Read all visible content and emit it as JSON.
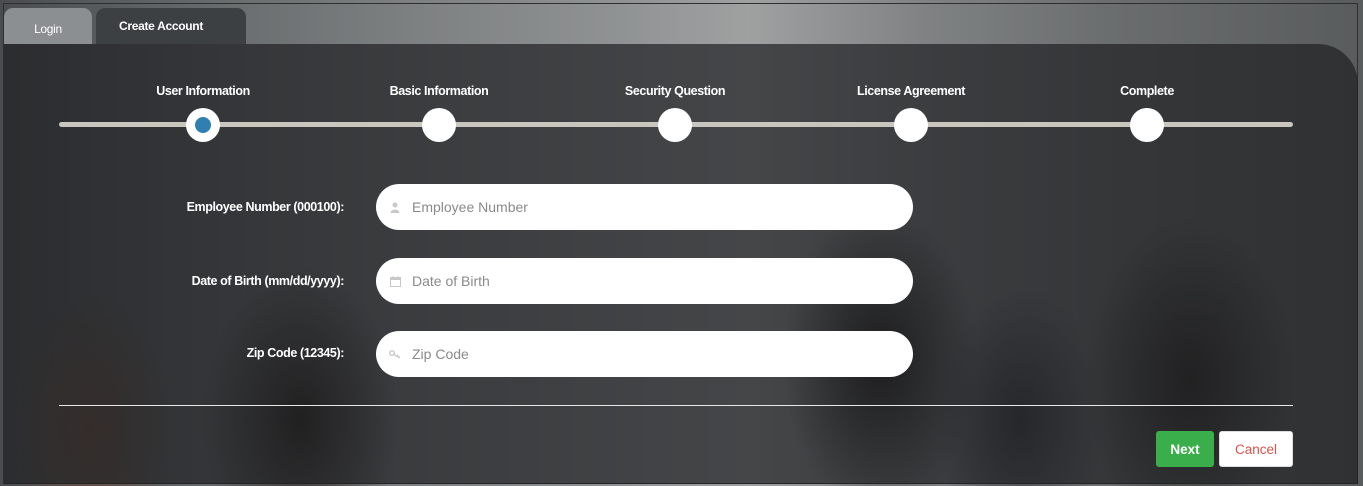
{
  "tabs": [
    {
      "label": "Login"
    },
    {
      "label": "Create Account"
    }
  ],
  "steps": [
    {
      "label": "User Information",
      "active": true
    },
    {
      "label": "Basic Information",
      "active": false
    },
    {
      "label": "Security Question",
      "active": false
    },
    {
      "label": "License Agreement",
      "active": false
    },
    {
      "label": "Complete",
      "active": false
    }
  ],
  "form": {
    "employee_number": {
      "label": "Employee Number (000100):",
      "placeholder": "Employee Number",
      "icon": "user-icon",
      "value": ""
    },
    "date_of_birth": {
      "label": "Date of Birth (mm/dd/yyyy):",
      "placeholder": "Date of Birth",
      "icon": "calendar-icon",
      "value": ""
    },
    "zip_code": {
      "label": "Zip Code (12345):",
      "placeholder": "Zip Code",
      "icon": "key-icon",
      "value": ""
    }
  },
  "buttons": {
    "next": "Next",
    "cancel": "Cancel"
  },
  "colors": {
    "active_step": "#2f7fb0",
    "next_button": "#3aae4a",
    "cancel_text": "#d9534f"
  }
}
